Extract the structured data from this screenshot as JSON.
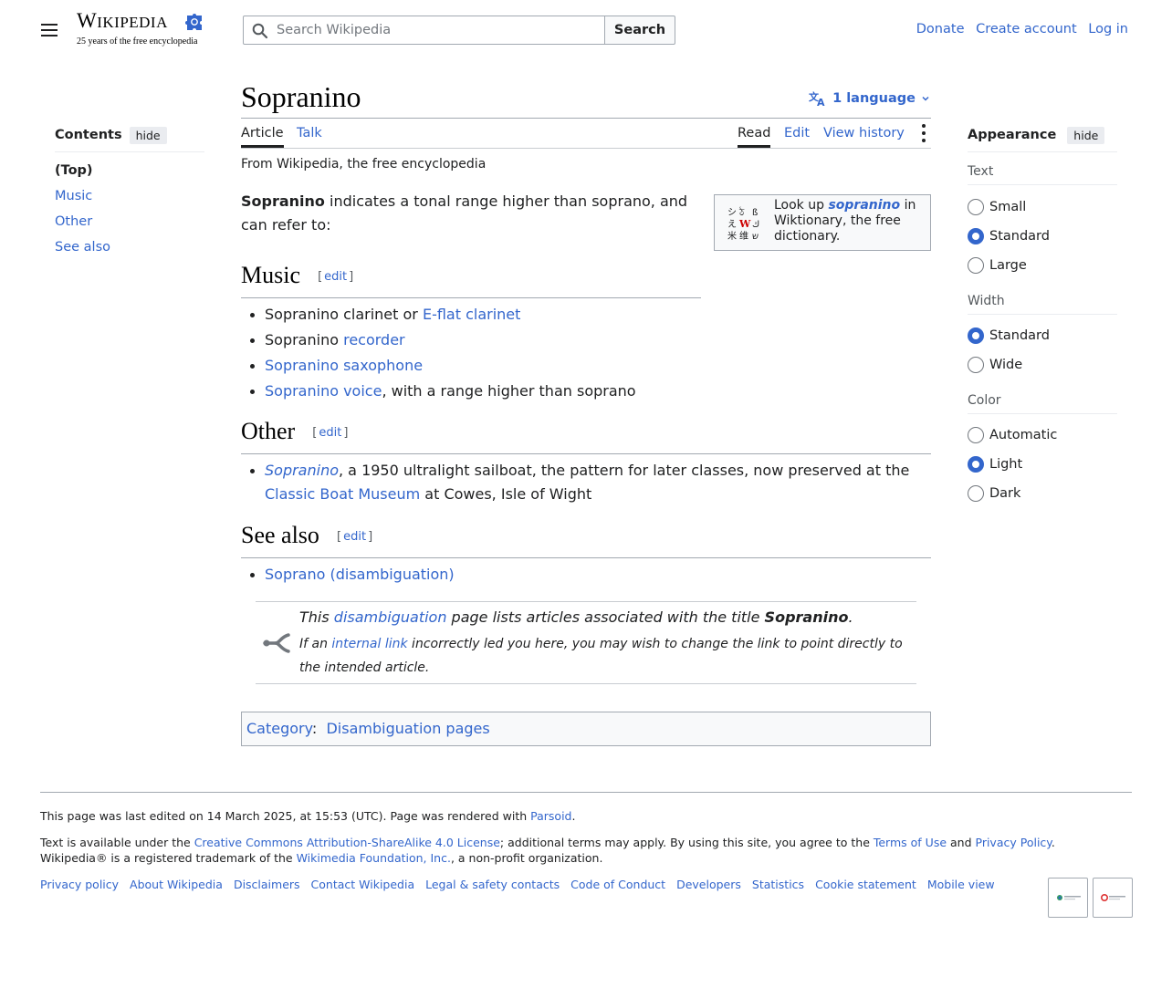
{
  "header": {
    "logo_wordmark_first": "W",
    "logo_wordmark_rest": "IKIPEDIA",
    "logo_tagline": "25 years of the free encyclopedia",
    "search_placeholder": "Search Wikipedia",
    "search_button": "Search",
    "user_links": [
      "Donate",
      "Create account",
      "Log in"
    ]
  },
  "toc": {
    "title": "Contents",
    "hide": "hide",
    "items": [
      "(Top)",
      "Music",
      "Other",
      "See also"
    ]
  },
  "appearance": {
    "title": "Appearance",
    "hide": "hide",
    "groups": [
      {
        "label": "Text",
        "options": [
          {
            "label": "Small",
            "checked": false
          },
          {
            "label": "Standard",
            "checked": true
          },
          {
            "label": "Large",
            "checked": false
          }
        ]
      },
      {
        "label": "Width",
        "options": [
          {
            "label": "Standard",
            "checked": true
          },
          {
            "label": "Wide",
            "checked": false
          }
        ]
      },
      {
        "label": "Color",
        "options": [
          {
            "label": "Automatic",
            "checked": false
          },
          {
            "label": "Light",
            "checked": true
          },
          {
            "label": "Dark",
            "checked": false
          }
        ]
      }
    ]
  },
  "page": {
    "title": "Sopranino",
    "language_button": "1 language",
    "tabs": {
      "article": "Article",
      "talk": "Talk",
      "read": "Read",
      "edit": "Edit",
      "history": "View history"
    },
    "tagline": "From Wikipedia, the free encyclopedia",
    "lead_bold": "Sopranino",
    "lead_rest": " indicates a tonal range higher than soprano, and can refer to:",
    "wiktionary": {
      "pre": "Look up ",
      "term": "sopranino",
      "post": " in Wiktionary, the free dictionary."
    },
    "edit_label": "edit",
    "sections": {
      "music": {
        "heading": "Music",
        "items": [
          {
            "text": "Sopranino clarinet or ",
            "link": "E-flat clarinet"
          },
          {
            "text": "Sopranino ",
            "link": "recorder"
          },
          {
            "link": "Sopranino saxophone"
          },
          {
            "link": "Sopranino voice",
            "text_after": ", with a range higher than soprano"
          }
        ]
      },
      "other": {
        "heading": "Other",
        "item_link": "Sopranino",
        "item_text": ", a 1950 ultralight sailboat, the pattern for later classes, now preserved at the ",
        "item_link2": "Classic Boat Museum",
        "item_text2": " at Cowes, Isle of Wight"
      },
      "see_also": {
        "heading": "See also",
        "item_link": "Soprano (disambiguation)"
      }
    },
    "disambig": {
      "pre": "This ",
      "link": "disambiguation",
      "mid": " page lists articles associated with the title ",
      "title": "Sopranino",
      "end": ".",
      "sub_pre": "If an ",
      "sub_link": "internal link",
      "sub_post": " incorrectly led you here, you may wish to change the link to point directly to the intended article."
    },
    "category": {
      "label": "Category",
      "sep": ":",
      "link": "Disambiguation pages"
    }
  },
  "footer": {
    "last_edited": "This page was last edited on 14 March 2025, at 15:53 (UTC). Page was rendered with ",
    "parsoid": "Parsoid",
    "license_pre": "Text is available under the ",
    "license_link": "Creative Commons Attribution-ShareAlike 4.0 License",
    "license_mid": "; additional terms may apply. By using this site, you agree to the ",
    "terms": "Terms of Use",
    "and": " and ",
    "privacy": "Privacy Policy",
    "trademark": ". Wikipedia® is a registered trademark of the ",
    "foundation": "Wikimedia Foundation, Inc.",
    "nonprofit": ", a non-profit organization.",
    "links": [
      "Privacy policy",
      "About Wikipedia",
      "Disclaimers",
      "Contact Wikipedia",
      "Legal & safety contacts",
      "Code of Conduct",
      "Developers",
      "Statistics",
      "Cookie statement",
      "Mobile view"
    ]
  },
  "colors": {
    "link": "#3366cc",
    "text": "#202122",
    "border": "#a2a9b1"
  }
}
